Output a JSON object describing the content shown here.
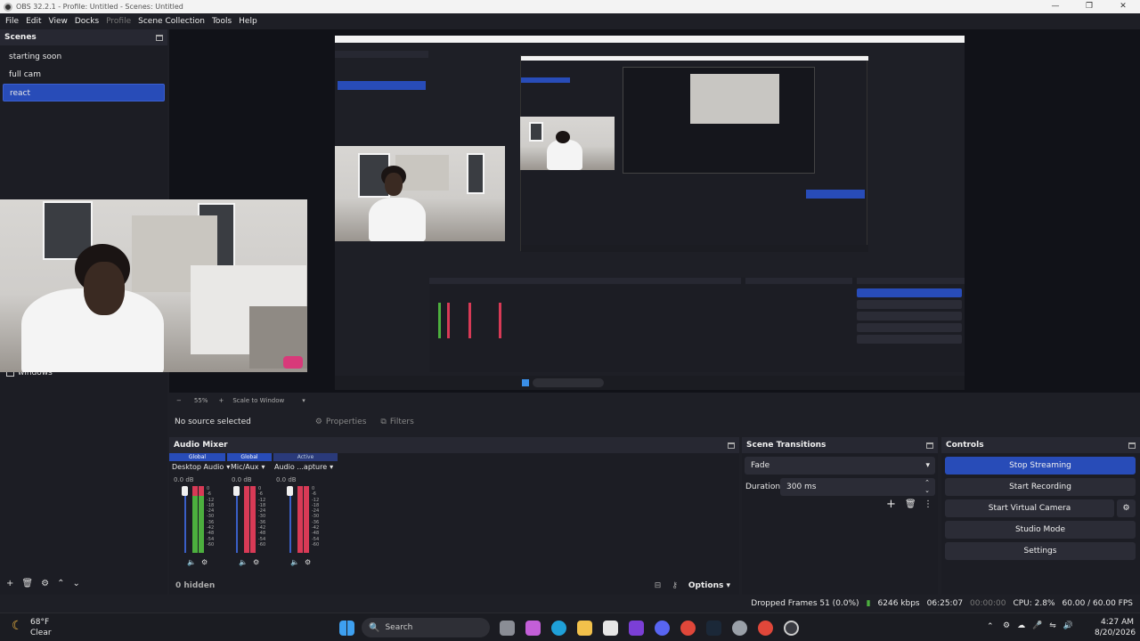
{
  "window": {
    "title": "OBS 32.2.1 - Profile: Untitled - Scenes: Untitled"
  },
  "menu": [
    {
      "label": "File",
      "dim": false
    },
    {
      "label": "Edit",
      "dim": false
    },
    {
      "label": "View",
      "dim": false
    },
    {
      "label": "Docks",
      "dim": false
    },
    {
      "label": "Profile",
      "dim": true
    },
    {
      "label": "Scene Collection",
      "dim": false
    },
    {
      "label": "Tools",
      "dim": false
    },
    {
      "label": "Help",
      "dim": false
    }
  ],
  "scenes": {
    "title": "Scenes",
    "items": [
      "starting soon",
      "full cam",
      "react"
    ],
    "selected": "react"
  },
  "sources": {
    "item": "windows"
  },
  "zoom": {
    "value": "55%",
    "mode": "Scale to Window"
  },
  "sourcebar": {
    "no_source": "No source selected",
    "properties": "Properties",
    "filters": "Filters"
  },
  "mixer": {
    "title": "Audio Mixer",
    "channels": [
      {
        "badge": "Global",
        "name": "Desktop Audio",
        "db": "0.0 dB"
      },
      {
        "badge": "Global",
        "name": "Mic/Aux",
        "db": "0.0 dB"
      },
      {
        "badge": "Active",
        "name": "Audio ...apture",
        "db": "0.0 dB"
      }
    ],
    "scale": [
      "0",
      "-6",
      "-12",
      "-18",
      "-24",
      "-30",
      "-36",
      "-42",
      "-48",
      "-54",
      "-60"
    ],
    "hidden": "0 hidden",
    "options": "Options"
  },
  "transitions": {
    "title": "Scene Transitions",
    "value": "Fade",
    "duration_label": "Duration",
    "duration": "300 ms"
  },
  "controls": {
    "title": "Controls",
    "stop_streaming": "Stop Streaming",
    "start_recording": "Start Recording",
    "start_virtual_camera": "Start Virtual Camera",
    "studio_mode": "Studio Mode",
    "settings": "Settings"
  },
  "status": {
    "dropped": "Dropped Frames 51 (0.0%)",
    "bitrate": "6246 kbps",
    "stream_time": "06:25:07",
    "rec_time": "00:00:00",
    "cpu": "CPU: 2.8%",
    "fps": "60.00 / 60.00 FPS"
  },
  "taskbar": {
    "weather_temp": "68°F",
    "weather_desc": "Clear",
    "search": "Search",
    "time": "4:27 AM",
    "date": "8/20/2026"
  },
  "colors": {
    "accent": "#284cb8",
    "panel": "#1c1d24",
    "meter_green": "#4caf3e",
    "meter_red": "#d83a56"
  }
}
